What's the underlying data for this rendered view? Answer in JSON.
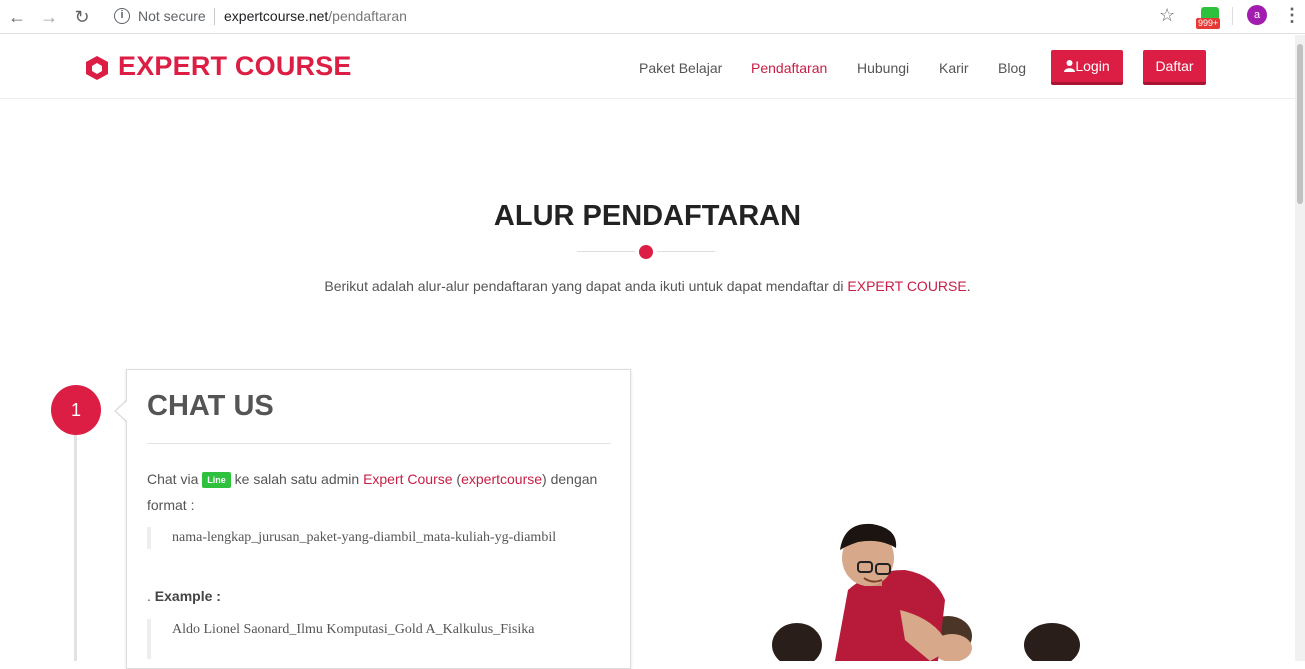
{
  "browser": {
    "security_label": "Not secure",
    "url_host": "expertcourse.net",
    "url_path": "/pendaftaran",
    "extension_badge": "999+",
    "profile_initial": "a",
    "icons": [
      "back-arrow-icon",
      "forward-arrow-icon",
      "reload-icon",
      "info-icon",
      "star-icon",
      "line-extension-icon",
      "kebab-menu-icon"
    ]
  },
  "header": {
    "logo_text": "EXPERT COURSE",
    "nav": [
      {
        "label": "Paket Belajar",
        "active": false
      },
      {
        "label": "Pendaftaran",
        "active": true
      },
      {
        "label": "Hubungi",
        "active": false
      },
      {
        "label": "Karir",
        "active": false
      },
      {
        "label": "Blog",
        "active": false
      }
    ],
    "login_label": "Login",
    "daftar_label": "Daftar"
  },
  "main": {
    "title": "ALUR PENDAFTARAN",
    "intro_prefix": "Berikut adalah alur-alur pendaftaran yang dapat anda ikuti untuk dapat mendaftar di ",
    "intro_brand": "EXPERT COURSE",
    "intro_suffix": "."
  },
  "step1": {
    "number": "1",
    "title": "CHAT US",
    "text_prefix": "Chat via ",
    "line_badge": "Line",
    "text_mid": " ke salah satu admin ",
    "admin_brand": "Expert Course",
    "text_paren_open": " (",
    "line_id": "expertcourse",
    "text_paren_close": ") dengan format :",
    "format": "nama-lengkap_jurusan_paket-yang-diambil_mata-kuliah-yg-diambil",
    "example_prefix": ". ",
    "example_label": "Example :",
    "example": "Aldo Lionel Saonard_Ilmu Komputasi_Gold A_Kalkulus_Fisika"
  },
  "colors": {
    "brand": "#dc1e45",
    "line_green": "#2ec13d"
  }
}
